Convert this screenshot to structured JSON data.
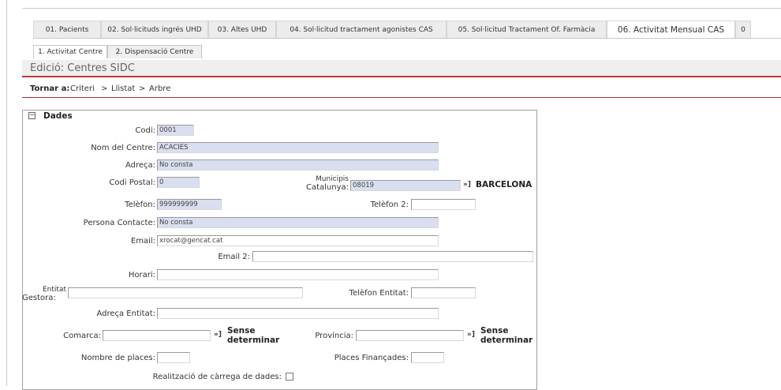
{
  "main_tabs": [
    {
      "label": "01. Pacients"
    },
    {
      "label": "02. Sol·licituds ingrés UHD"
    },
    {
      "label": "03. Altes UHD"
    },
    {
      "label": "04. Sol·licitud tractament agonistes CAS"
    },
    {
      "label": "05. Sol·licitud Tractament Of. Farmàcia"
    },
    {
      "label": "06. Activitat Mensual CAS"
    },
    {
      "label": "0"
    }
  ],
  "sub_tabs": [
    {
      "label": "1. Activitat Centre"
    },
    {
      "label": "2. Dispensació Centre"
    }
  ],
  "page_title": "Edició: Centres SIDC",
  "nav": {
    "label": "Tornar a:",
    "crumbs": [
      "Criteri",
      "Llistat",
      "Arbre"
    ],
    "separator": ">"
  },
  "section": {
    "collapse_glyph": "−",
    "title": "Dades"
  },
  "form": {
    "codi": {
      "label": "Codi:",
      "value": "0001"
    },
    "nom_centre": {
      "label": "Nom del Centre:",
      "value": "ACACIES"
    },
    "adreca": {
      "label": "Adreça:",
      "value": "No consta"
    },
    "codi_postal": {
      "label": "Codi Postal:",
      "value": "0"
    },
    "municipis": {
      "label_line1": "Municipis",
      "label_line2": "Catalunya:",
      "value": "08019",
      "arrow": "»]",
      "resolved": "BARCELONA"
    },
    "telefon": {
      "label": "Telèfon:",
      "value": "999999999"
    },
    "telefon2": {
      "label": "Telèfon 2:",
      "value": ""
    },
    "persona_contacte": {
      "label": "Persona Contacte:",
      "value": "No consta"
    },
    "email": {
      "label": "Email:",
      "value": "xrocat@gencat.cat"
    },
    "email2": {
      "label": "Email 2:",
      "value": ""
    },
    "horari": {
      "label": "Horari:",
      "value": ""
    },
    "entitat_gestora": {
      "label_line1": "Entitat",
      "label_line2": "Gestora:",
      "value": ""
    },
    "telefon_entitat": {
      "label": "Telèfon Entitat:",
      "value": ""
    },
    "adreca_entitat": {
      "label": "Adreça Entitat:",
      "value": ""
    },
    "comarca": {
      "label": "Comarca:",
      "value": "",
      "arrow": "»]",
      "resolved_line1": "Sense",
      "resolved_line2": "determinar"
    },
    "provincia": {
      "label": "Província:",
      "value": "",
      "arrow": "»]",
      "resolved_line1": "Sense",
      "resolved_line2": "determinar"
    },
    "nombre_places": {
      "label": "Nombre de places:",
      "value": ""
    },
    "places_financades": {
      "label": "Places Finançades:",
      "value": ""
    },
    "carrega_dades": {
      "label": "Realització de càrrega de dades:",
      "checked": false
    }
  }
}
